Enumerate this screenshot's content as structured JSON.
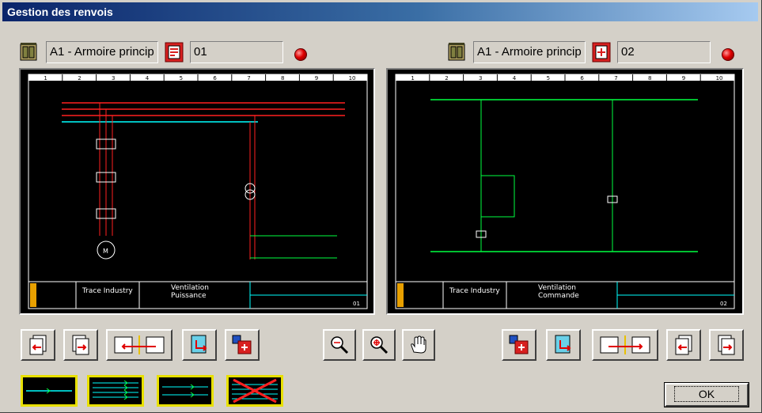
{
  "window": {
    "title": "Gestion des renvois"
  },
  "left_panel": {
    "cabinet": "A1 - Armoire princip",
    "sheet": "01",
    "frame_columns": [
      "1",
      "2",
      "3",
      "4",
      "5",
      "6",
      "7",
      "8",
      "9",
      "10"
    ],
    "title_block": {
      "company": "Trace Industry",
      "subtitle": "Ventilation",
      "description": "Puissance",
      "sheet_no": "01"
    }
  },
  "right_panel": {
    "cabinet": "A1 - Armoire princip",
    "sheet": "02",
    "frame_columns": [
      "1",
      "2",
      "3",
      "4",
      "5",
      "6",
      "7",
      "8",
      "9",
      "10"
    ],
    "title_block": {
      "company": "Trace Industry",
      "subtitle": "Ventilation",
      "description": "Commande",
      "sheet_no": "02"
    }
  },
  "footer": {
    "ok_label": "OK"
  },
  "colors": {
    "wire_red": "#ff2020",
    "wire_cyan": "#00ffff",
    "wire_green": "#00ff40",
    "frame_white": "#ffffff",
    "accent_yellow": "#e8e000"
  }
}
